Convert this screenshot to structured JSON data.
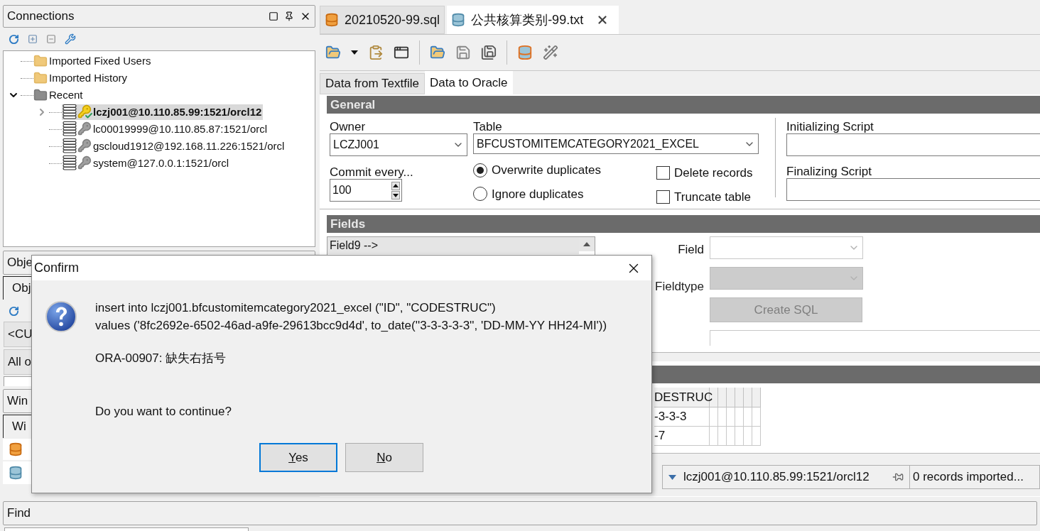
{
  "connections_panel": {
    "title": "Connections",
    "tree": [
      {
        "label": "Imported Fixed Users",
        "kind": "folder"
      },
      {
        "label": "Imported History",
        "kind": "folder"
      },
      {
        "label": "Recent",
        "kind": "gray_folder",
        "expanded": true,
        "children": [
          {
            "label": "lczj001@10.110.85.99:1521/orcl12",
            "kind": "connection",
            "selected": true,
            "connected": true,
            "expandable": true
          },
          {
            "label": "lc00019999@10.110.85.87:1521/orcl",
            "kind": "connection",
            "selected": false,
            "connected": false,
            "expandable": false
          },
          {
            "label": "gscloud1912@192.168.11.226:1521/orcl",
            "kind": "connection",
            "selected": false,
            "connected": false,
            "expandable": false
          },
          {
            "label": "system@127.0.0.1:1521/orcl",
            "kind": "connection",
            "selected": false,
            "connected": false,
            "expandable": false
          }
        ]
      }
    ]
  },
  "objects_panel": {
    "title": "Obje",
    "tab": "Obj",
    "filter": "<CU",
    "combo": "All o"
  },
  "windows_panel": {
    "title": "Win",
    "tab": "Wi"
  },
  "find_panel": {
    "title": "Find"
  },
  "editor_tabs": [
    {
      "label": "20210520-99.sql",
      "kind": "sql",
      "selected": false
    },
    {
      "label": "公共核算类别-99.txt",
      "kind": "import",
      "selected": true
    }
  ],
  "sub_tabs": [
    {
      "label": "Data from Textfile",
      "selected": false
    },
    {
      "label": "Data to Oracle",
      "selected": true
    }
  ],
  "general": {
    "title": "General",
    "owner_label": "Owner",
    "owner": "LCZJ001",
    "table_label": "Table",
    "table": "BFCUSTOMITEMCATEGORY2021_EXCEL",
    "commit_label": "Commit every...",
    "commit": "100",
    "duplicates": [
      {
        "label": "Overwrite duplicates",
        "selected": true
      },
      {
        "label": "Ignore duplicates",
        "selected": false
      }
    ],
    "options": [
      {
        "label": "Delete records",
        "checked": false
      },
      {
        "label": "Truncate table",
        "checked": false
      }
    ],
    "init_label": "Initializing Script",
    "final_label": "Finalizing Script"
  },
  "fields": {
    "title": "Fields",
    "list_item": "Field9 -->",
    "field_label": "Field",
    "fieldtype_label": "Fieldtype",
    "fieldtype_disabled": true,
    "create_sql": "Create SQL",
    "create_sql_disabled": true
  },
  "grid": {
    "columns": [
      "DESTRUC"
    ],
    "rows": [
      [
        "-3-3-3"
      ],
      [
        "-7"
      ]
    ]
  },
  "status": {
    "connection": "lczj001@10.110.85.99:1521/orcl12",
    "message": "0 records imported..."
  },
  "dialog": {
    "title": "Confirm",
    "lines": [
      "insert into lczj001.bfcustomitemcategory2021_excel (\"ID\", \"CODESTRUC\")",
      "values ('8fc2692e-6502-46ad-a9fe-29613bcc9d4d', to_date(''3-3-3-3-3'', 'DD-MM-YY HH24-MI'))"
    ],
    "error": "ORA-00907: 缺失右括号",
    "question": "Do you want to continue?",
    "buttons": [
      {
        "label": "Yes",
        "selected": true
      },
      {
        "label": "No",
        "selected": false
      }
    ]
  }
}
